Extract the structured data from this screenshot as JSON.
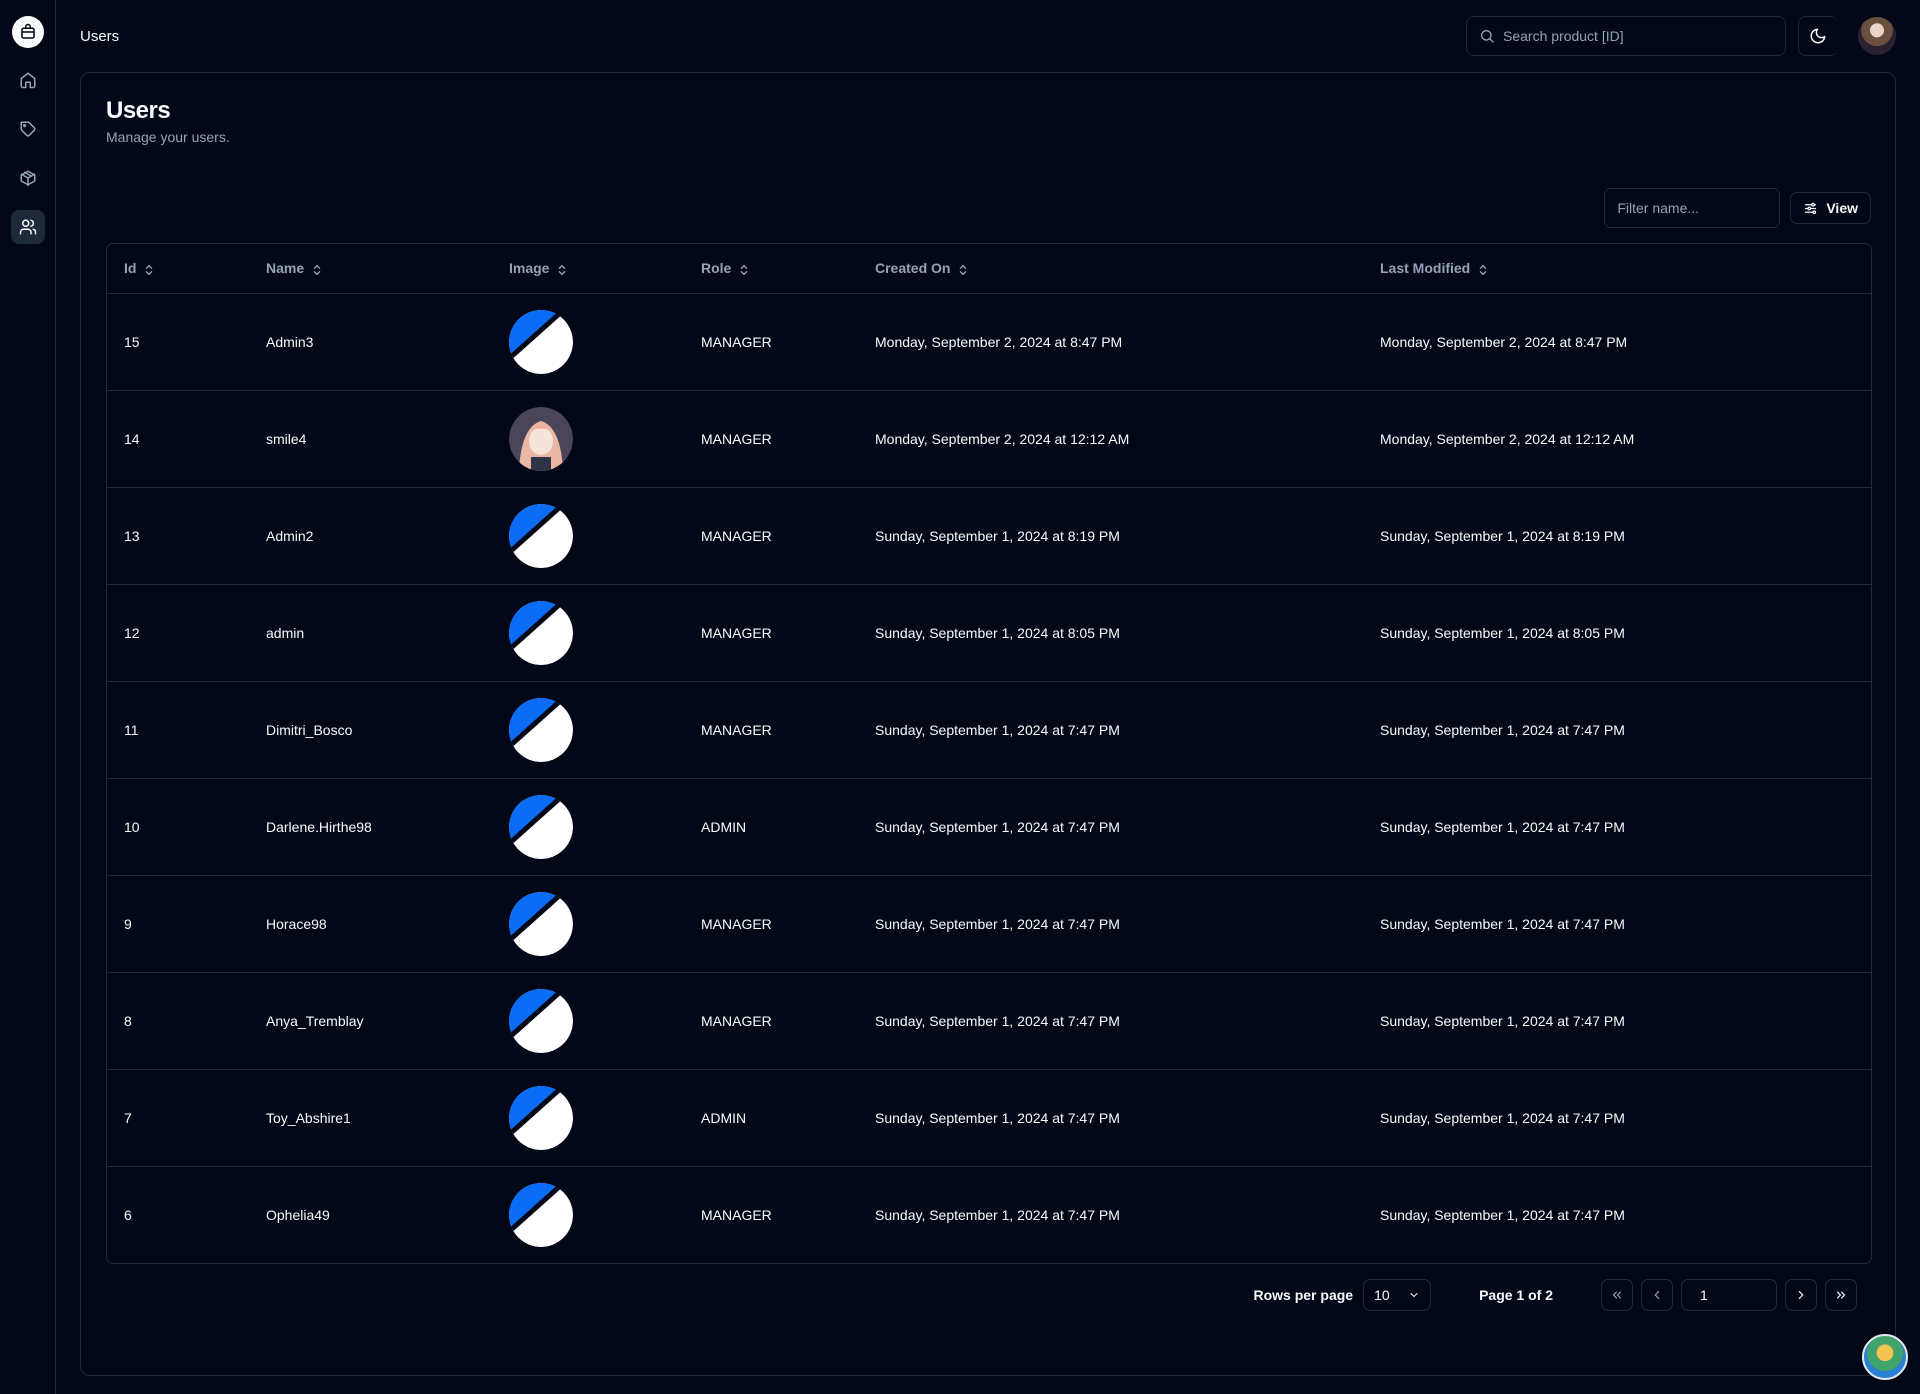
{
  "header": {
    "breadcrumb": "Users",
    "search_placeholder": "Search product [ID]"
  },
  "sidebar": {
    "items": [
      {
        "name": "home"
      },
      {
        "name": "tag"
      },
      {
        "name": "package"
      },
      {
        "name": "users",
        "active": true
      }
    ]
  },
  "page": {
    "title": "Users",
    "description": "Manage your users."
  },
  "toolbar": {
    "filter_placeholder": "Filter name...",
    "view_label": "View"
  },
  "table": {
    "columns": [
      "Id",
      "Name",
      "Image",
      "Role",
      "Created On",
      "Last Modified"
    ],
    "rows": [
      {
        "id": "15",
        "name": "Admin3",
        "image": "default",
        "role": "MANAGER",
        "created": "Monday, September 2, 2024 at 8:47 PM",
        "modified": "Monday, September 2, 2024 at 8:47 PM"
      },
      {
        "id": "14",
        "name": "smile4",
        "image": "photo",
        "role": "MANAGER",
        "created": "Monday, September 2, 2024 at 12:12 AM",
        "modified": "Monday, September 2, 2024 at 12:12 AM"
      },
      {
        "id": "13",
        "name": "Admin2",
        "image": "default",
        "role": "MANAGER",
        "created": "Sunday, September 1, 2024 at 8:19 PM",
        "modified": "Sunday, September 1, 2024 at 8:19 PM"
      },
      {
        "id": "12",
        "name": "admin",
        "image": "default",
        "role": "MANAGER",
        "created": "Sunday, September 1, 2024 at 8:05 PM",
        "modified": "Sunday, September 1, 2024 at 8:05 PM"
      },
      {
        "id": "11",
        "name": "Dimitri_Bosco",
        "image": "default",
        "role": "MANAGER",
        "created": "Sunday, September 1, 2024 at 7:47 PM",
        "modified": "Sunday, September 1, 2024 at 7:47 PM"
      },
      {
        "id": "10",
        "name": "Darlene.Hirthe98",
        "image": "default",
        "role": "ADMIN",
        "created": "Sunday, September 1, 2024 at 7:47 PM",
        "modified": "Sunday, September 1, 2024 at 7:47 PM"
      },
      {
        "id": "9",
        "name": "Horace98",
        "image": "default",
        "role": "MANAGER",
        "created": "Sunday, September 1, 2024 at 7:47 PM",
        "modified": "Sunday, September 1, 2024 at 7:47 PM"
      },
      {
        "id": "8",
        "name": "Anya_Tremblay",
        "image": "default",
        "role": "MANAGER",
        "created": "Sunday, September 1, 2024 at 7:47 PM",
        "modified": "Sunday, September 1, 2024 at 7:47 PM"
      },
      {
        "id": "7",
        "name": "Toy_Abshire1",
        "image": "default",
        "role": "ADMIN",
        "created": "Sunday, September 1, 2024 at 7:47 PM",
        "modified": "Sunday, September 1, 2024 at 7:47 PM"
      },
      {
        "id": "6",
        "name": "Ophelia49",
        "image": "default",
        "role": "MANAGER",
        "created": "Sunday, September 1, 2024 at 7:47 PM",
        "modified": "Sunday, September 1, 2024 at 7:47 PM"
      }
    ]
  },
  "pagination": {
    "rows_per_page_label": "Rows per page",
    "rows_per_page_value": "10",
    "page_info": "Page 1 of 2",
    "page_input": "1"
  },
  "colors": {
    "background": "#020817",
    "border": "#1e293b",
    "muted_text": "#94a3b8",
    "avatar_blue": "#0b6cf5"
  }
}
